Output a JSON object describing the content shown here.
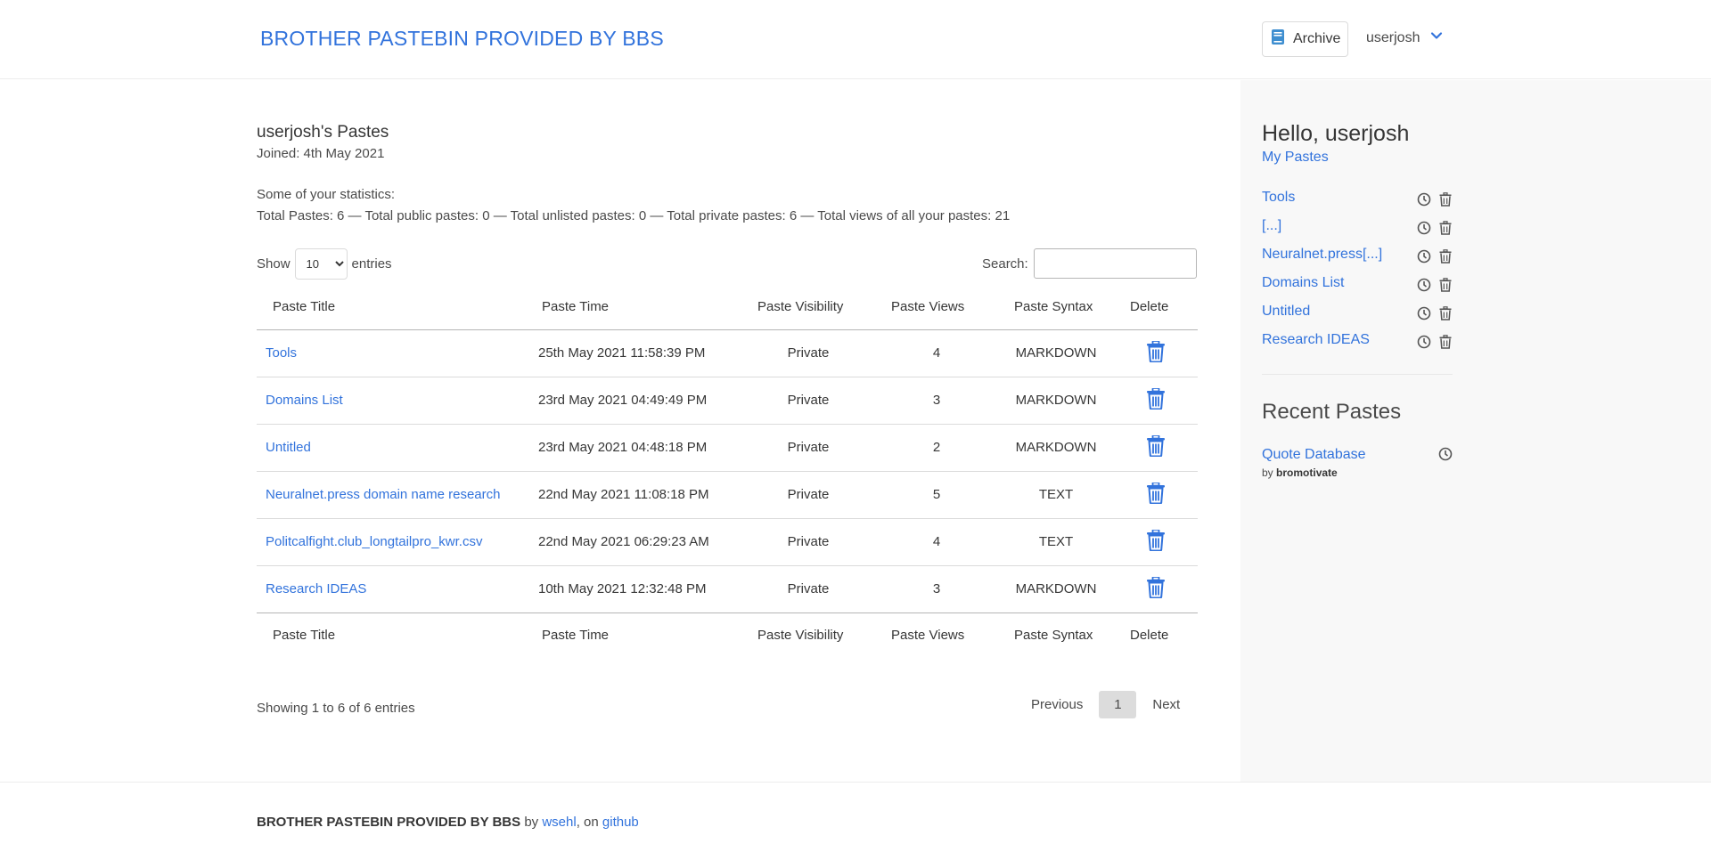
{
  "header": {
    "brand": "BROTHER PASTEBIN PROVIDED BY BBS",
    "archive_label": "Archive",
    "username": "userjosh"
  },
  "main": {
    "title": "userjosh's Pastes",
    "joined": "Joined: 4th May 2021",
    "stats_label": "Some of your statistics:",
    "stats_text": "Total Pastes: 6 — Total public pastes: 0 — Total unlisted pastes: 0 — Total private pastes: 6 — Total views of all your pastes: 21",
    "show_label": "Show",
    "entries_label": "entries",
    "entries_selected": "10",
    "search_label": "Search:",
    "search_value": "",
    "columns": [
      "Paste Title",
      "Paste Time",
      "Paste Visibility",
      "Paste Views",
      "Paste Syntax",
      "Delete"
    ],
    "rows": [
      {
        "title": "Tools",
        "time": "25th May 2021 11:58:39 PM",
        "visibility": "Private",
        "views": "4",
        "syntax": "MARKDOWN"
      },
      {
        "title": "Domains List",
        "time": "23rd May 2021 04:49:49 PM",
        "visibility": "Private",
        "views": "3",
        "syntax": "MARKDOWN"
      },
      {
        "title": "Untitled",
        "time": "23rd May 2021 04:48:18 PM",
        "visibility": "Private",
        "views": "2",
        "syntax": "MARKDOWN"
      },
      {
        "title": "Neuralnet.press domain name research",
        "time": "22nd May 2021 11:08:18 PM",
        "visibility": "Private",
        "views": "5",
        "syntax": "TEXT"
      },
      {
        "title": "Politcalfight.club_longtailpro_kwr.csv",
        "time": "22nd May 2021 06:29:23 AM",
        "visibility": "Private",
        "views": "4",
        "syntax": "TEXT"
      },
      {
        "title": "Research IDEAS",
        "time": "10th May 2021 12:32:48 PM",
        "visibility": "Private",
        "views": "3",
        "syntax": "MARKDOWN"
      }
    ],
    "showing_text": "Showing 1 to 6 of 6 entries",
    "pager": {
      "previous": "Previous",
      "page": "1",
      "next": "Next"
    }
  },
  "sidebar": {
    "hello": "Hello, userjosh",
    "my_pastes": "My Pastes",
    "items": [
      {
        "label": "Tools"
      },
      {
        "label": "[...]"
      },
      {
        "label": "Neuralnet.press[...]"
      },
      {
        "label": "Domains List"
      },
      {
        "label": "Untitled"
      },
      {
        "label": "Research IDEAS"
      }
    ],
    "recent_title": "Recent Pastes",
    "recent": [
      {
        "title": "Quote Database",
        "by": "by",
        "author": "bromotivate"
      }
    ]
  },
  "footer": {
    "brand": "BROTHER PASTEBIN PROVIDED BY BBS",
    "by": "by",
    "author_link": "wsehl",
    "on": ", on",
    "github_link": "github"
  },
  "icons": {
    "archive": "book-icon",
    "dropdown": "chevron-down-icon",
    "clock": "clock-icon",
    "trash": "trash-icon"
  },
  "colors": {
    "link": "#3273dc",
    "sidebar_bg": "#f8f8f8",
    "page_button_bg": "#dcdcdc"
  }
}
